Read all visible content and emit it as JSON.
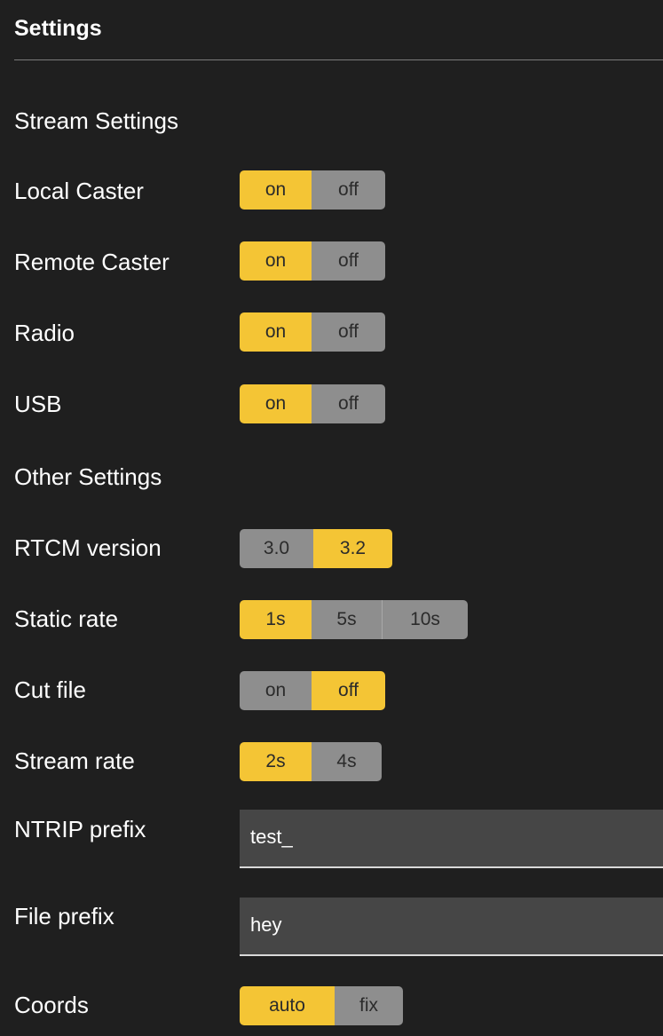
{
  "header": {
    "title": "Settings"
  },
  "sections": {
    "stream": "Stream Settings",
    "other": "Other Settings"
  },
  "stream_settings": {
    "local_caster": {
      "label": "Local Caster",
      "options": [
        "on",
        "off"
      ],
      "selected": "on"
    },
    "remote_caster": {
      "label": "Remote Caster",
      "options": [
        "on",
        "off"
      ],
      "selected": "on"
    },
    "radio": {
      "label": "Radio",
      "options": [
        "on",
        "off"
      ],
      "selected": "on"
    },
    "usb": {
      "label": "USB",
      "options": [
        "on",
        "off"
      ],
      "selected": "on"
    }
  },
  "other_settings": {
    "rtcm_version": {
      "label": "RTCM version",
      "options": [
        "3.0",
        "3.2"
      ],
      "selected": "3.2"
    },
    "static_rate": {
      "label": "Static rate",
      "options": [
        "1s",
        "5s",
        "10s"
      ],
      "selected": "1s"
    },
    "cut_file": {
      "label": "Cut file",
      "options": [
        "on",
        "off"
      ],
      "selected": "off"
    },
    "stream_rate": {
      "label": "Stream rate",
      "options": [
        "2s",
        "4s"
      ],
      "selected": "2s"
    },
    "ntrip_prefix": {
      "label": "NTRIP prefix",
      "value": "test_"
    },
    "file_prefix": {
      "label": "File prefix",
      "value": "hey"
    },
    "coords": {
      "label": "Coords",
      "options": [
        "auto",
        "fix"
      ],
      "selected": "auto"
    }
  },
  "colors": {
    "background": "#1f1f1f",
    "active": "#f4c535",
    "inactive": "#8e8e8e",
    "field": "#464646"
  }
}
